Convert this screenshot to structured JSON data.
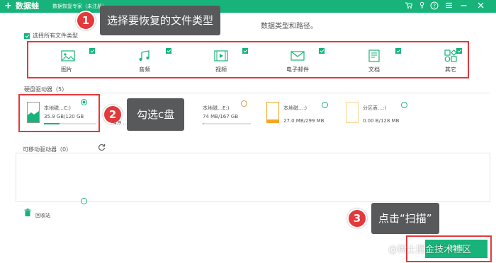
{
  "app": {
    "logo": "+",
    "name": "数据蛙",
    "subtitle": "数据恢复专家（未注册）",
    "accent": "#17b37a",
    "titlebar_icons": [
      "cart-icon",
      "key-icon",
      "help-icon",
      "menu-icon",
      "minimize-icon",
      "close-icon"
    ]
  },
  "hint_tail": "数据类型和路径。",
  "file_types": {
    "select_all_label": "选择所有文件类型",
    "select_all_checked": true,
    "items": [
      {
        "label": "图片",
        "icon": "image-icon",
        "checked": true
      },
      {
        "label": "音频",
        "icon": "music-icon",
        "checked": true
      },
      {
        "label": "视频",
        "icon": "video-icon",
        "checked": true
      },
      {
        "label": "电子邮件",
        "icon": "email-icon",
        "checked": true
      },
      {
        "label": "文档",
        "icon": "document-icon",
        "checked": true
      },
      {
        "label": "其它",
        "icon": "other-icon",
        "checked": true
      }
    ]
  },
  "drives": {
    "section_label": "硬盘驱动器（5）",
    "items": [
      {
        "name": "本地磁…C:)",
        "size": "35.9 GB/120 GB",
        "used": 0.3,
        "selected": true,
        "color": "#17b37a"
      },
      {
        "name": "本地磁…",
        "size": "4.9 …",
        "used": 0.1,
        "selected": false,
        "color": "#555555"
      },
      {
        "name": "本地磁…E:)",
        "size": "74 MB/167 GB",
        "used": 0.01,
        "selected": false,
        "color": "#555555"
      },
      {
        "name": "本地磁…:)",
        "size": "27.0 MB/299 MB",
        "used": 0.09,
        "selected": false,
        "color": "#f5a623"
      },
      {
        "name": "分区表…:)",
        "size": "0.00 B/128 MB",
        "used": 0,
        "selected": false,
        "color": "#f5d58a"
      }
    ]
  },
  "removable": {
    "section_label": "可移动驱动器（0）"
  },
  "recycle": {
    "label": "回收站"
  },
  "scan_button": "扫描",
  "steps": [
    {
      "num": "1",
      "text": "选择要恢复的文件类型"
    },
    {
      "num": "2",
      "text": "勾选c盘"
    },
    {
      "num": "3",
      "text": "点击“扫描”"
    }
  ],
  "watermark": "@稀土掘金技术社区"
}
